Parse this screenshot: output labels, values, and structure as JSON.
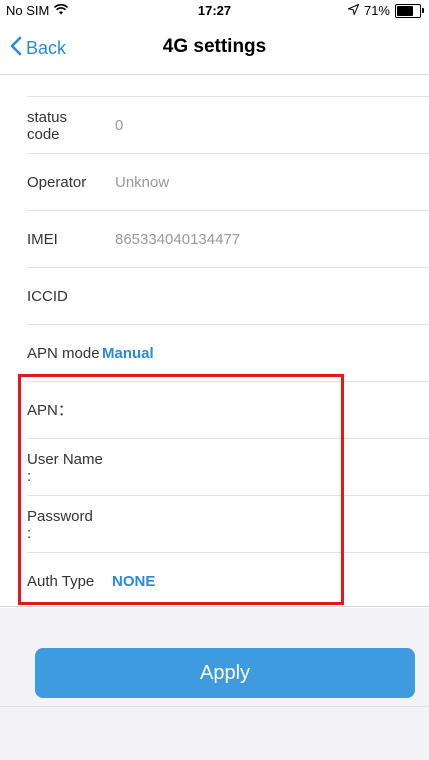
{
  "status_bar": {
    "carrier": "No SIM",
    "time": "17:27",
    "battery": "71%",
    "battery_level": 0.71
  },
  "nav": {
    "back_label": "Back",
    "title": "4G settings"
  },
  "rows": {
    "status_code": {
      "label_line1": "status",
      "label_line2": "code",
      "value": "0"
    },
    "operator": {
      "label": "Operator",
      "value": "Unknow"
    },
    "imei": {
      "label": "IMEI",
      "value": "865334040134477"
    },
    "iccid": {
      "label": "ICCID",
      "value": ""
    },
    "apn_mode": {
      "label": "APN mode",
      "value": "Manual"
    },
    "apn": {
      "label": "APN：",
      "value": ""
    },
    "user_name": {
      "label_line1": "User Name",
      "label_line2": ":",
      "value": ""
    },
    "password": {
      "label_line1": "Password",
      "label_line2": ":",
      "value": ""
    },
    "auth_type": {
      "label": "Auth Type",
      "value": "NONE"
    }
  },
  "apply_label": "Apply",
  "colors": {
    "accent": "#2a8adf",
    "button": "#3d9bde",
    "highlight": "#e8161b"
  }
}
